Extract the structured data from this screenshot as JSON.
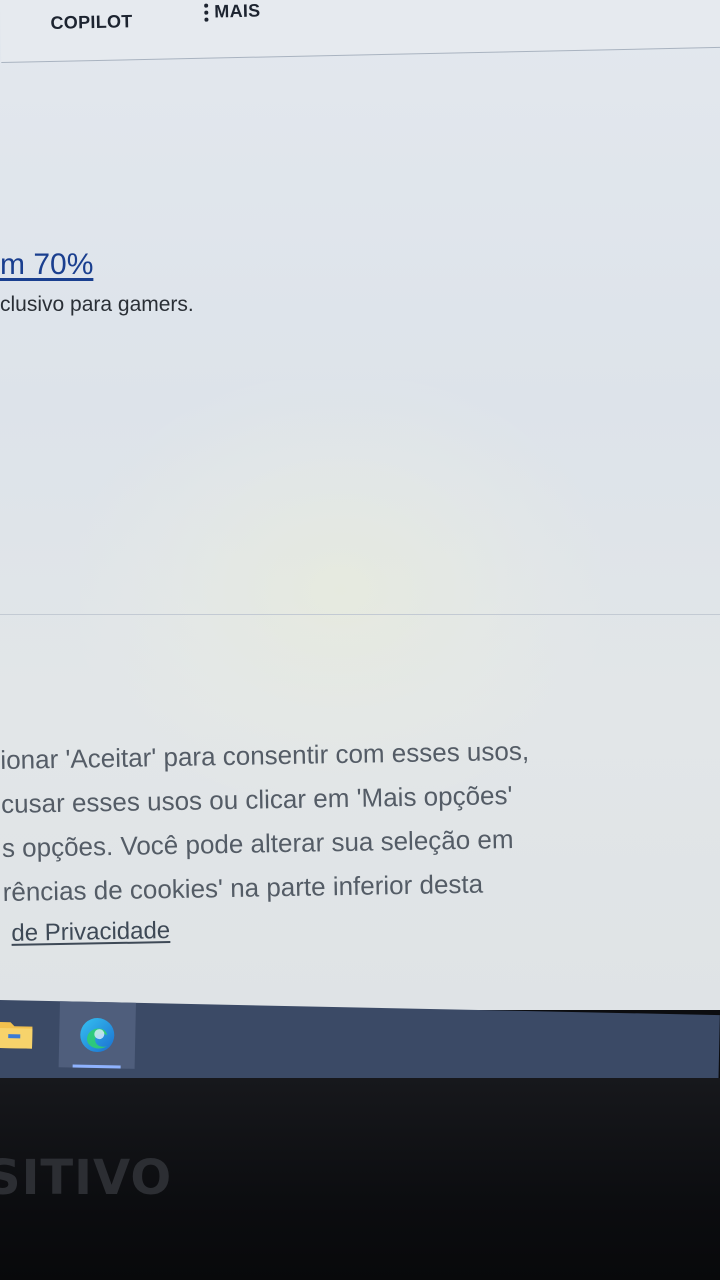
{
  "topbar": {
    "copilot_label": "COPILOT",
    "more_label": "MAIS"
  },
  "promo": {
    "title": "m 70%",
    "subtitle": "clusivo para gamers."
  },
  "consent": {
    "lines": [
      "ionar 'Aceitar' para consentir com esses usos,",
      "cusar esses usos ou clicar em 'Mais opções'",
      "s opções. Você pode alterar sua seleção em",
      "rências de cookies' na parte inferior desta"
    ],
    "privacy_link": "de Privacidade"
  },
  "taskbar": {
    "items": [
      "folder-icon",
      "edge-icon"
    ]
  },
  "bezel": {
    "brand": "SITIVO"
  },
  "colors": {
    "link": "#1a3f8f",
    "taskbar": "#3b4a66",
    "page_bg": "#e3e8ee"
  }
}
